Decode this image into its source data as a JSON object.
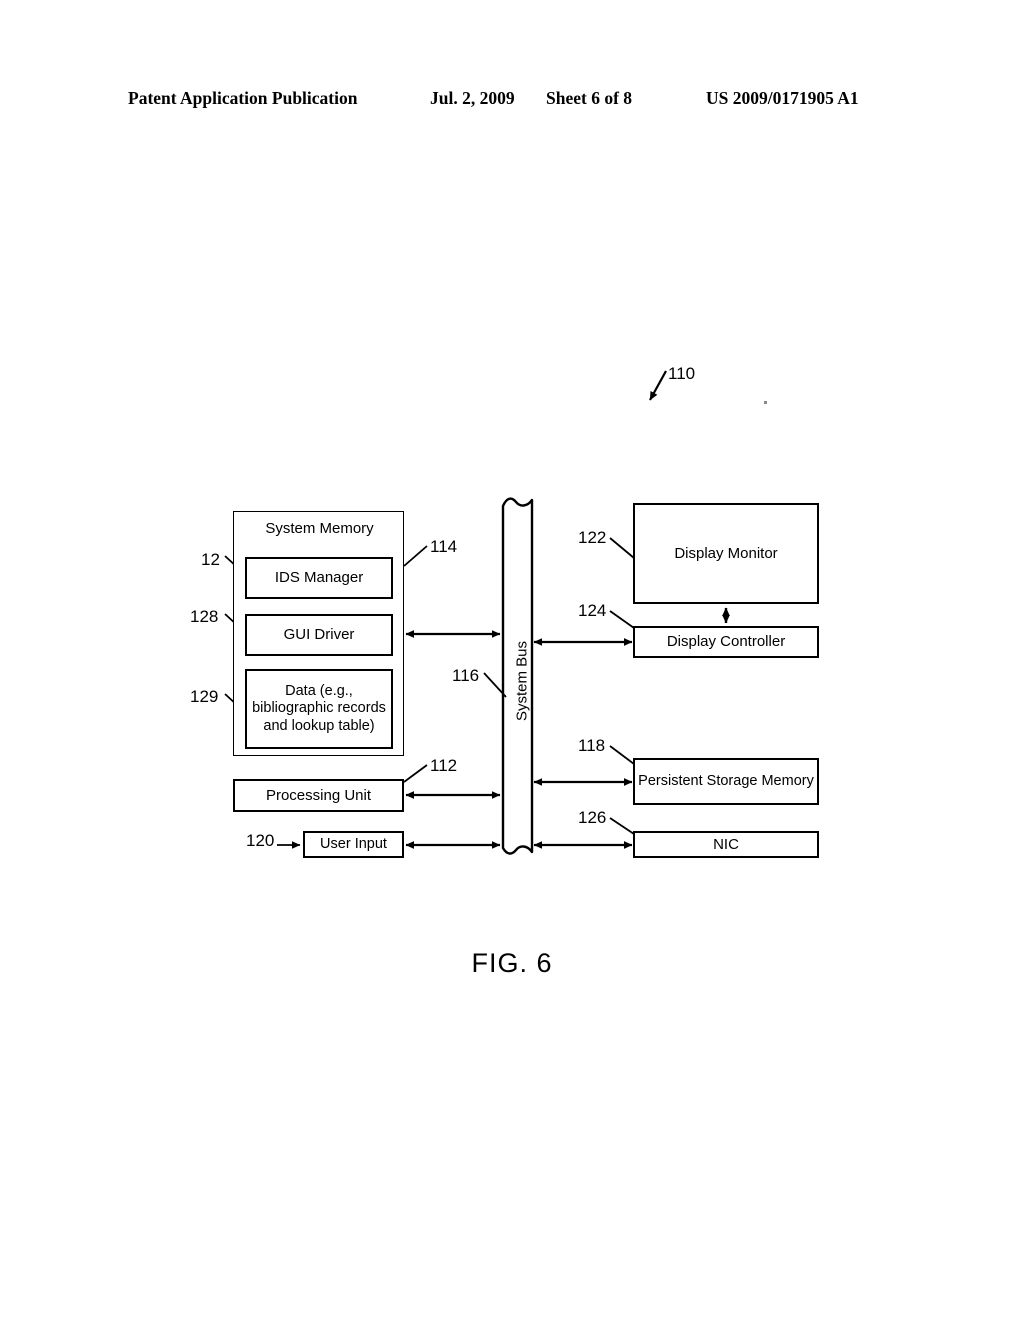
{
  "header": {
    "title": "Patent Application Publication",
    "date": "Jul. 2, 2009",
    "sheet": "Sheet 6 of 8",
    "publication_number": "US 2009/0171905 A1"
  },
  "figure": {
    "caption": "FIG. 6",
    "system_reference": "110",
    "blocks": {
      "system_memory": {
        "label": "System Memory",
        "ref": "114"
      },
      "ids_manager": {
        "label": "IDS Manager",
        "ref": "12"
      },
      "gui_driver": {
        "label": "GUI Driver",
        "ref": "128"
      },
      "data_block": {
        "label": "Data (e.g., bibliographic records and lookup table)",
        "ref": "129"
      },
      "processing_unit": {
        "label": "Processing Unit",
        "ref": "112"
      },
      "user_input": {
        "label": "User Input",
        "ref": "120"
      },
      "system_bus": {
        "label": "System Bus",
        "ref": "116"
      },
      "display_monitor": {
        "label": "Display Monitor",
        "ref": "122"
      },
      "display_controller": {
        "label": "Display Controller",
        "ref": "124"
      },
      "persistent_storage": {
        "label": "Persistent Storage Memory",
        "ref": "118"
      },
      "nic": {
        "label": "NIC",
        "ref": "126"
      }
    }
  }
}
